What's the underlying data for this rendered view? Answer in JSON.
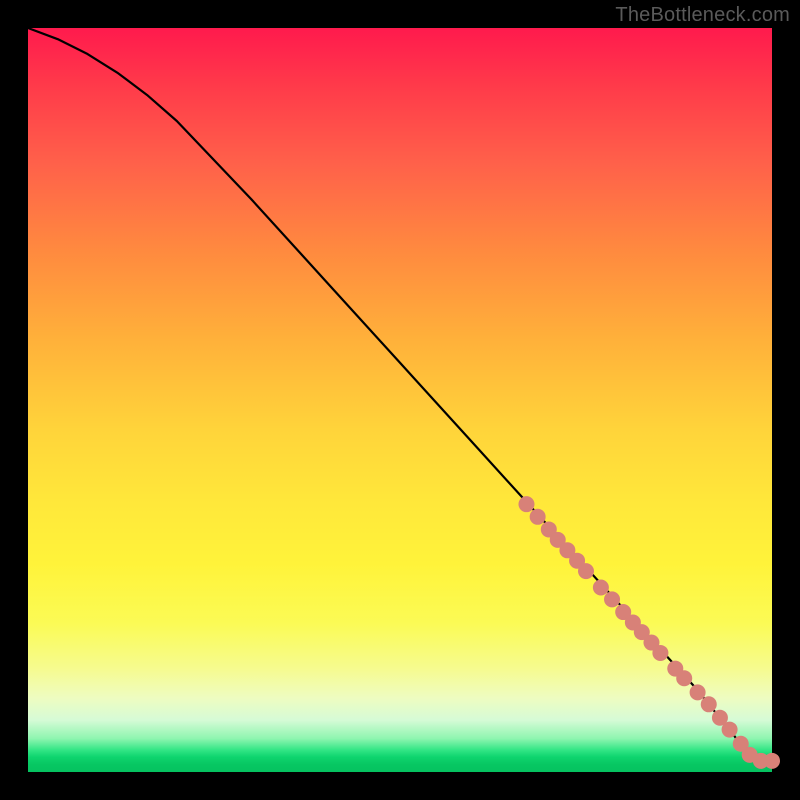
{
  "watermark": "TheBottleneck.com",
  "chart_data": {
    "type": "line",
    "title": "",
    "xlabel": "",
    "ylabel": "",
    "xlim": [
      0,
      100
    ],
    "ylim": [
      0,
      100
    ],
    "grid": false,
    "series": [
      {
        "name": "curve",
        "x": [
          0,
          4,
          8,
          12,
          16,
          20,
          30,
          40,
          50,
          60,
          70,
          80,
          90,
          94,
          96,
          98,
          100
        ],
        "y": [
          100,
          98.5,
          96.5,
          94,
          91,
          87.5,
          77,
          66,
          55,
          44,
          33,
          22,
          11,
          6,
          3.5,
          1.5,
          1.5
        ]
      }
    ],
    "markers": {
      "name": "highlighted-points",
      "color": "#d88178",
      "radius": 8,
      "points": [
        {
          "x": 67.0,
          "y": 36.0
        },
        {
          "x": 68.5,
          "y": 34.3
        },
        {
          "x": 70.0,
          "y": 32.6
        },
        {
          "x": 71.2,
          "y": 31.2
        },
        {
          "x": 72.5,
          "y": 29.8
        },
        {
          "x": 73.8,
          "y": 28.4
        },
        {
          "x": 75.0,
          "y": 27.0
        },
        {
          "x": 77.0,
          "y": 24.8
        },
        {
          "x": 78.5,
          "y": 23.2
        },
        {
          "x": 80.0,
          "y": 21.5
        },
        {
          "x": 81.3,
          "y": 20.1
        },
        {
          "x": 82.5,
          "y": 18.8
        },
        {
          "x": 83.8,
          "y": 17.4
        },
        {
          "x": 85.0,
          "y": 16.0
        },
        {
          "x": 87.0,
          "y": 13.9
        },
        {
          "x": 88.2,
          "y": 12.6
        },
        {
          "x": 90.0,
          "y": 10.7
        },
        {
          "x": 91.5,
          "y": 9.1
        },
        {
          "x": 93.0,
          "y": 7.3
        },
        {
          "x": 94.3,
          "y": 5.7
        },
        {
          "x": 95.8,
          "y": 3.8
        },
        {
          "x": 97.0,
          "y": 2.3
        },
        {
          "x": 98.5,
          "y": 1.5
        },
        {
          "x": 100.0,
          "y": 1.5
        }
      ]
    }
  }
}
